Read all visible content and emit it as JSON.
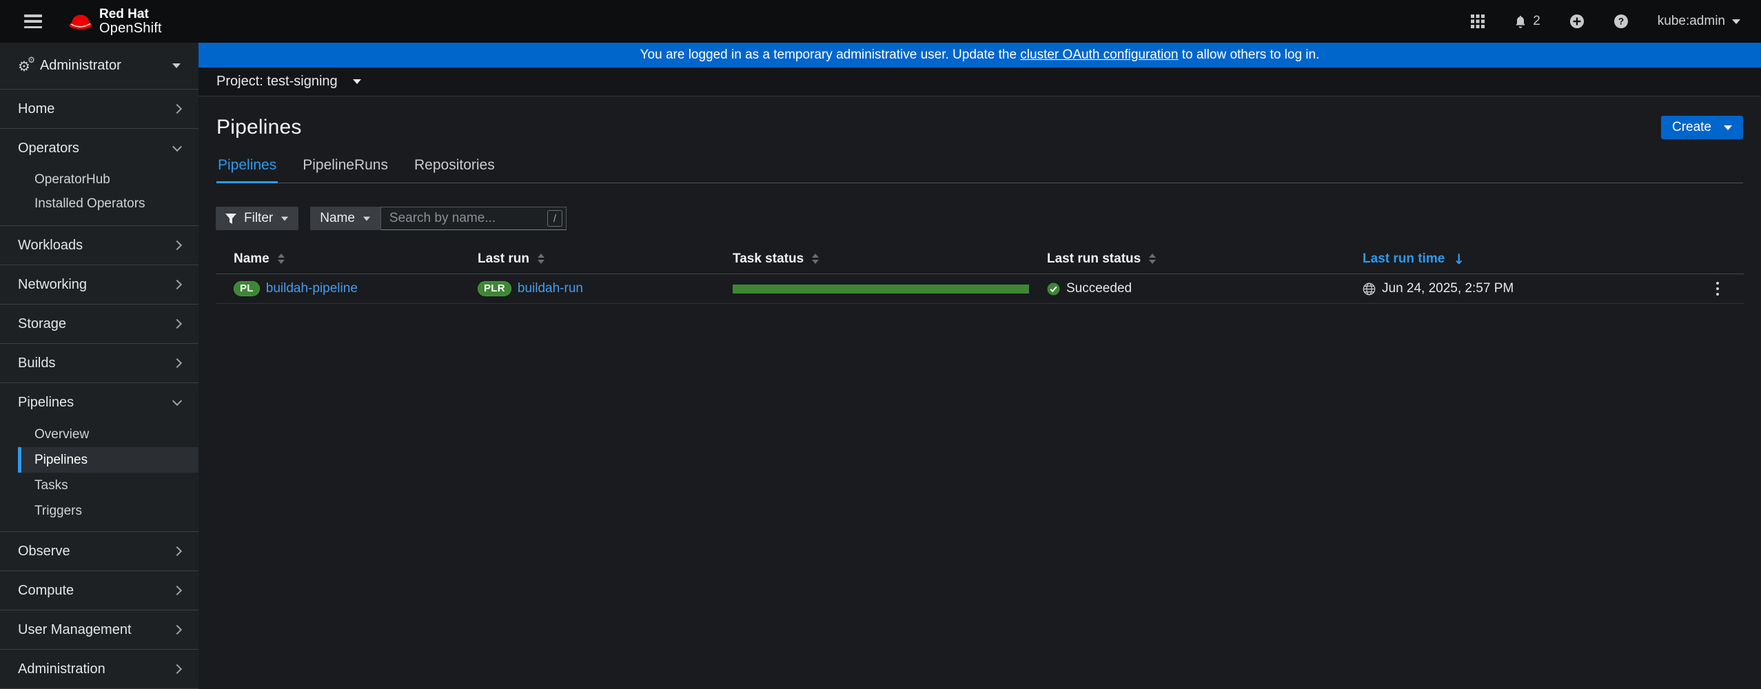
{
  "masthead": {
    "brand": {
      "line1": "Red Hat",
      "line2": "OpenShift"
    },
    "notification_count": "2",
    "user_name": "kube:admin"
  },
  "banner": {
    "prefix": "You are logged in as a temporary administrative user. Update the ",
    "link_text": "cluster OAuth configuration",
    "suffix": " to allow others to log in."
  },
  "project_bar": {
    "label": "Project: test-signing"
  },
  "page": {
    "title": "Pipelines",
    "create_button": "Create"
  },
  "tabs": {
    "items": [
      {
        "label": "Pipelines"
      },
      {
        "label": "PipelineRuns"
      },
      {
        "label": "Repositories"
      }
    ]
  },
  "toolbar": {
    "filter_label": "Filter",
    "attribute_label": "Name",
    "search_placeholder": "Search by name...",
    "search_shortcut": "/"
  },
  "table": {
    "headers": [
      "Name",
      "Last run",
      "Task status",
      "Last run status",
      "Last run time"
    ],
    "sorted_by": "Last run time",
    "sort_direction": "descending",
    "row": {
      "name_badge": "PL",
      "name": "buildah-pipeline",
      "last_run_badge": "PLR",
      "last_run": "buildah-run",
      "task_status_percent": 100,
      "last_run_status": "Succeeded",
      "last_run_time": "Jun 24, 2025, 2:57 PM"
    }
  },
  "sidebar": {
    "perspective": "Administrator",
    "items": [
      {
        "label": "Home"
      },
      {
        "label": "Operators",
        "children": [
          "OperatorHub",
          "Installed Operators"
        ]
      },
      {
        "label": "Workloads"
      },
      {
        "label": "Networking"
      },
      {
        "label": "Storage"
      },
      {
        "label": "Builds"
      },
      {
        "label": "Pipelines",
        "children": [
          "Overview",
          "Pipelines",
          "Tasks",
          "Triggers"
        ],
        "active_child": "Pipelines"
      },
      {
        "label": "Observe"
      },
      {
        "label": "Compute"
      },
      {
        "label": "User Management"
      },
      {
        "label": "Administration"
      }
    ]
  },
  "colors": {
    "banner_blue": "#0066cc",
    "accent_blue": "#2b9af3",
    "link_blue": "#479ced",
    "success_green": "#3e8635",
    "badge_green": "#3e8635"
  }
}
